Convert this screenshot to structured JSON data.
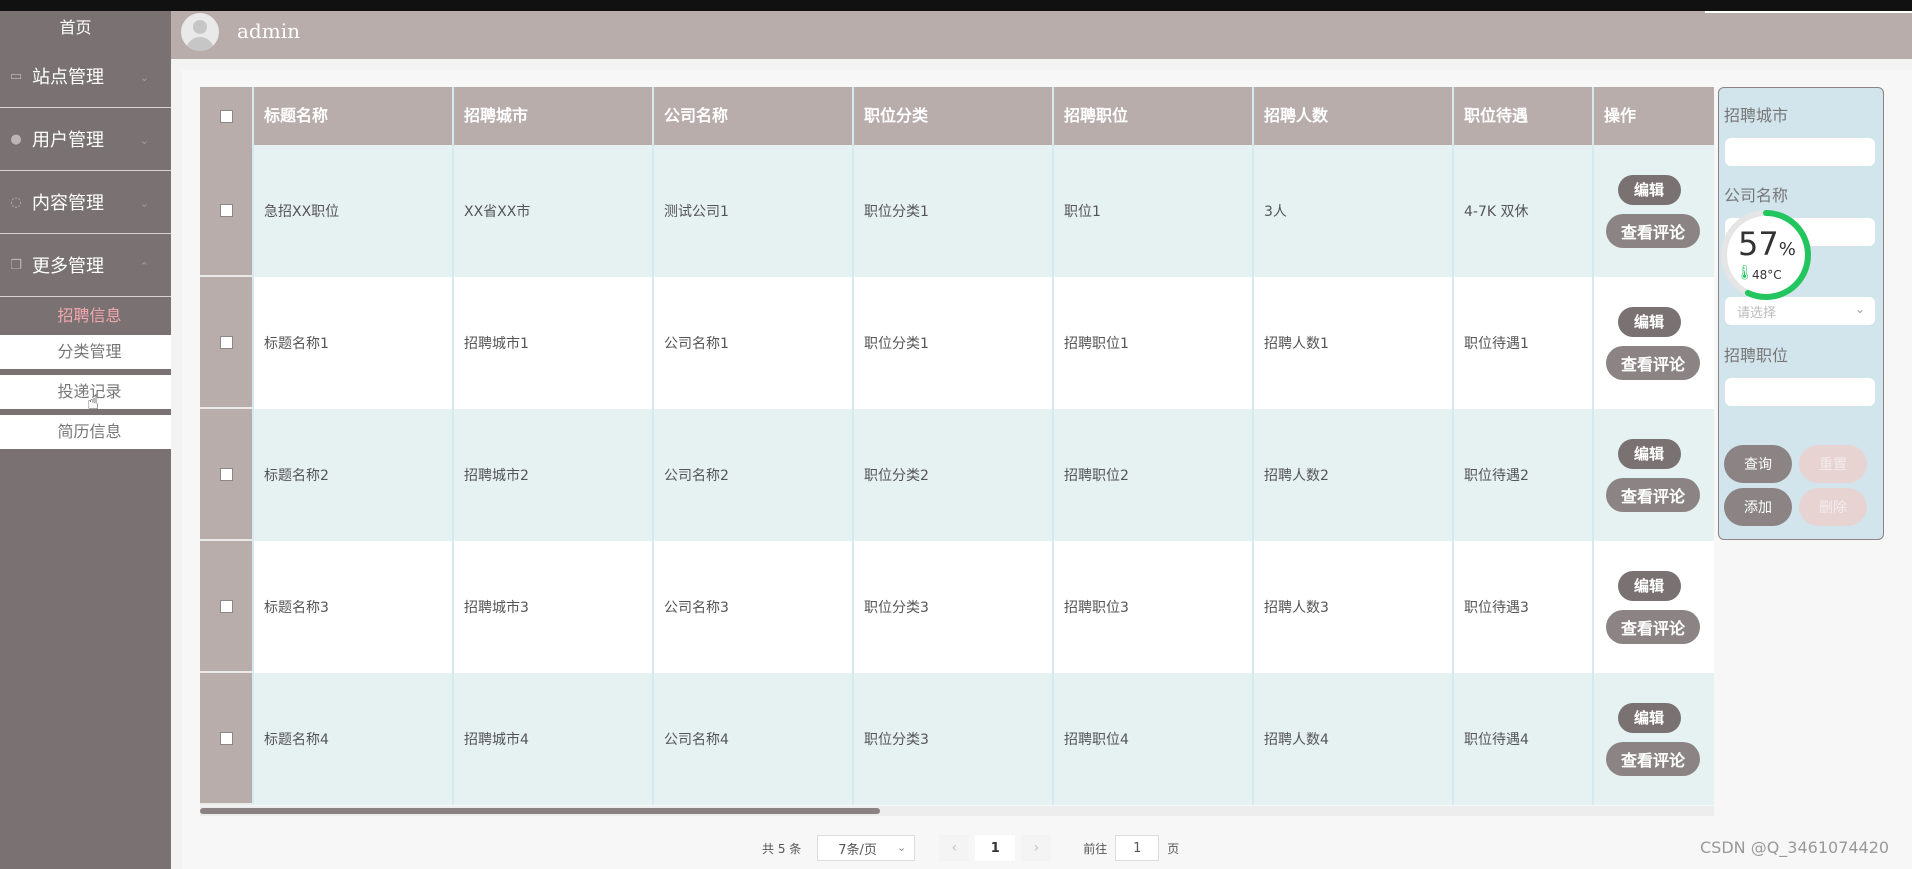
{
  "sidebar": {
    "home": "首页",
    "groups": [
      {
        "label": "站点管理",
        "icon": "monitor-icon"
      },
      {
        "label": "用户管理",
        "icon": "user-icon"
      },
      {
        "label": "内容管理",
        "icon": "chat-icon"
      },
      {
        "label": "更多管理",
        "icon": "copy-icon"
      }
    ],
    "subitems": [
      "招聘信息",
      "分类管理",
      "投递记录",
      "简历信息"
    ]
  },
  "header": {
    "username": "admin"
  },
  "table": {
    "columns": [
      "标题名称",
      "招聘城市",
      "公司名称",
      "职位分类",
      "招聘职位",
      "招聘人数",
      "职位待遇",
      "操作"
    ],
    "rows": [
      [
        "急招XX职位",
        "XX省XX市",
        "测试公司1",
        "职位分类1",
        "职位1",
        "3人",
        "4-7K 双休"
      ],
      [
        "标题名称1",
        "招聘城市1",
        "公司名称1",
        "职位分类1",
        "招聘职位1",
        "招聘人数1",
        "职位待遇1"
      ],
      [
        "标题名称2",
        "招聘城市2",
        "公司名称2",
        "职位分类2",
        "招聘职位2",
        "招聘人数2",
        "职位待遇2"
      ],
      [
        "标题名称3",
        "招聘城市3",
        "公司名称3",
        "职位分类3",
        "招聘职位3",
        "招聘人数3",
        "职位待遇3"
      ],
      [
        "标题名称4",
        "招聘城市4",
        "公司名称4",
        "职位分类3",
        "招聘职位4",
        "招聘人数4",
        "职位待遇4"
      ]
    ],
    "edit_label": "编辑",
    "view_label": "查看评论"
  },
  "pagination": {
    "total": "共 5 条",
    "page_size": "7条/页",
    "prev": "‹",
    "next": "›",
    "current": "1",
    "goto_prefix": "前往",
    "goto_value": "1",
    "goto_suffix": "页"
  },
  "search": {
    "city_label": "招聘城市",
    "company_label": "公司名称",
    "select_placeholder": "请选择",
    "position_label": "招聘职位",
    "query": "查询",
    "reset": "重置",
    "add": "添加",
    "delete": "删除"
  },
  "gauge": {
    "percent": "57",
    "unit": "%",
    "temp": "48°C",
    "value": 0.57,
    "color": "#22c55e"
  },
  "watermark": "CSDN @Q_3461074420",
  "colors": {
    "sidebar": "#7a7272",
    "header": "#b8adab",
    "active": "#f2a7ad",
    "panel": "#d2e4ec"
  }
}
